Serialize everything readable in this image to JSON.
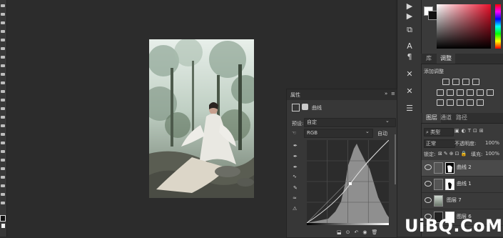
{
  "properties_panel": {
    "title": "属性",
    "collapse_label": "»",
    "menu_label": "≡",
    "adjustment_name": "曲线",
    "preset_label": "预设:",
    "preset_value": "自定",
    "channel_value": "RGB",
    "auto_button": "自动"
  },
  "color_panel": {
    "hue_strip": "hue-slider"
  },
  "library_panel": {
    "tabs": [
      "库",
      "调整"
    ],
    "add_adjustment_label": "添加调整"
  },
  "layers_panel": {
    "tabs": [
      "图层",
      "通道",
      "路径"
    ],
    "filter_label": "类型",
    "blend_mode": "正常",
    "opacity_label": "不透明度:",
    "opacity_value": "100%",
    "lock_label": "锁定:",
    "fill_label": "填充:",
    "fill_value": "100%",
    "layers": [
      {
        "name": "曲线 2"
      },
      {
        "name": "曲线 1"
      },
      {
        "name": "图层 7"
      },
      {
        "name": "图层 6"
      }
    ]
  },
  "watermark": {
    "text": "UiBQ.CoM"
  }
}
